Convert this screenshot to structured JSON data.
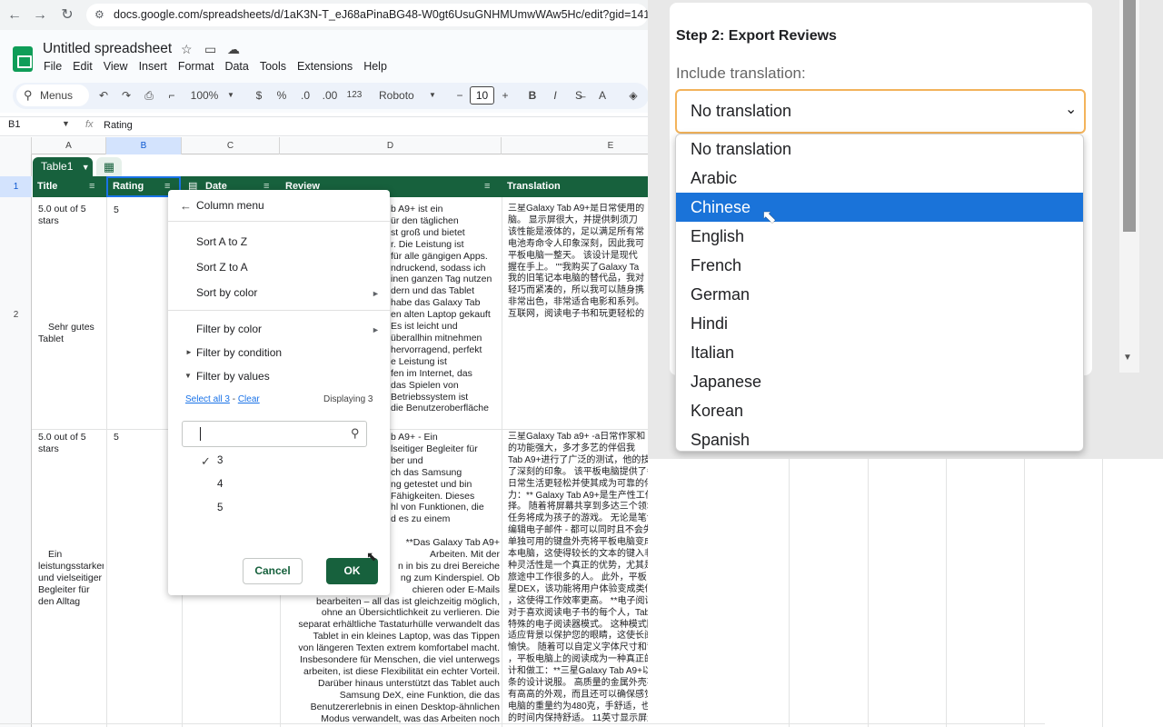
{
  "browser": {
    "url": "docs.google.com/spreadsheets/d/1aK3N-T_eJ68aPinaBG48-W0gt6UsuGNHMUmwWAw5Hc/edit?gid=141198715#gid"
  },
  "sheets": {
    "title": "Untitled spreadsheet",
    "menu": [
      "File",
      "Edit",
      "View",
      "Insert",
      "Format",
      "Data",
      "Tools",
      "Extensions",
      "Help"
    ],
    "toolbar": {
      "menus_search": "Menus",
      "zoom": "100%",
      "currency": "$",
      "percent": "%",
      "dec_decrease": ".0",
      "dec_increase": ".00",
      "number_format": "123",
      "font": "Roboto",
      "font_size": "10",
      "minus": "−",
      "plus": "+",
      "bold": "B",
      "italic": "I"
    },
    "name_box": "B1",
    "formula_value": "Rating",
    "columns": [
      "A",
      "B",
      "C",
      "D",
      "E"
    ],
    "rows": [
      "1",
      "2"
    ],
    "table_name": "Table1",
    "headers": [
      "Title",
      "Rating",
      "Date",
      "Review",
      "Translation"
    ],
    "row2": {
      "title_top": "5.0 out of 5 stars",
      "title_mid": "Sehr gutes Tablet",
      "rating": "5",
      "review": "b A9+ ist ein\nür den täglichen\nst groß und bietet\nr. Die Leistung ist\nfür alle gängigen Apps.\nndruckend, sodass ich\ninen ganzen Tag nutzen\ndern und das Tablet\nhabe das Galaxy Tab\nen alten Laptop gekauft\nEs ist leicht und\nüberallhin mitnehmen\nhervorragend, perfekt\ne Leistung ist\nfen im Internet, das\ndas Spielen von\nBetriebssystem ist\ndie Benutzeroberfläche",
      "translation": "三星Galaxy Tab A9+是日常使用的\n脑。 显示屏很大，并提供刺须刀\n该性能是液体的，足以满足所有常\n电池寿命令人印象深刻，因此我可\n平板电脑一整天。 该设计是现代\n握在手上。 \"\"我购买了Galaxy Ta\n我的旧笔记本电脑的替代品，我对\n轻巧而紧凑的，所以我可以随身携\n非常出色，非常适合电影和系列。\n互联网，阅读电子书和玩更轻松的"
    },
    "row3": {
      "title_top": "5.0 out of 5 stars",
      "title_mid": "Ein leistungsstarker und vielseitiger Begleiter für den Alltag",
      "rating": "5",
      "review_top": "b A9+ - Ein\nlseitiger Begleiter für\nber und\nch das Samsung\nng getestet und bin\nFähigkeiten. Dieses\nhl von Funktionen, die\nd es zu einem",
      "review_bottom": "**Das Galaxy Tab A9+\nArbeiten. Mit der\nn in bis zu drei Bereiche\nng zum Kinderspiel. Ob\nchieren oder E-Mails\nbearbeiten – all das ist gleichzeitig möglich,\nohne an Übersichtlichkeit zu verlieren. Die\nseparat erhältliche Tastaturhülle verwandelt das\nTablet in ein kleines Laptop, was das Tippen\nvon längeren Texten extrem komfortabel macht.\nInsbesondere für Menschen, die viel unterwegs\narbeiten, ist diese Flexibilität ein echter Vorteil.\nDarüber hinaus unterstützt das Tablet auch\nSamsung DeX, eine Funktion, die das\nBenutzererlebnis in einen Desktop-ähnlichen\nModus verwandelt, was das Arbeiten noch",
      "translation": "三星Galaxy Tab a9+ -a日常作家和\n的功能强大，多才多艺的伴侣我\nTab A9+进行了广泛的测试，他的技能给我留下\n了深刻的印象。 该平板电脑提供了各种功能，使\n日常生活更轻松并使其成为可靠的伴侣：**生产\n力：** Galaxy Tab A9+是生产性工作的理想选\n择。 随着将屏幕共享到多达三个领域的功能，多\n任务将成为孩子的游戏。 无论是笔记，研究还是\n编辑电子邮件 - 都可以同时且不会失去清晰度。\n单独可用的键盘外壳将平板电脑变成一台小笔记\n本电脑，这使得较长的文本的键入非常舒适。 这\n种灵活性是一个真正的优势，尤其是对于那些在\n旅途中工作很多的人。 此外，平板电脑还支持三\n星DEX，该功能将用户体验变成类似桌面的模式\n，这使得工作效率更高。 **电子阅读器模式：**\n对于喜欢阅读电子书的每个人，Tab A9+提供了\n特殊的电子阅读器模式。 这种模式降低了色温并\n适应背景以保护您的眼睛，这使长阅读会议更加\n愉快。 随着可以自定义字体尺寸和背景的可能性\n，平板电脑上的阅读成为一种真正的乐趣。 **设\n计和做工：**三星Galaxy Tab A9+以其优雅而苗\n条的设计说服。 高质量的金属外壳不仅使设备具\n有高高的外观，而且还可以确保感觉良好。 平板\n电脑的重量约为480克，手舒适，也可以在更长\n的时间内保持舒适。 11英寸显示屏还提供了出"
    }
  },
  "column_menu": {
    "title": "Column menu",
    "sort_a_z": "Sort A to Z",
    "sort_z_a": "Sort Z to A",
    "sort_by_color": "Sort by color",
    "filter_by_color": "Filter by color",
    "filter_by_condition": "Filter by condition",
    "filter_by_values": "Filter by values",
    "select_all": "Select all 3",
    "separator": " - ",
    "clear": "Clear",
    "displaying": "Displaying 3",
    "values": [
      {
        "label": "3",
        "checked": true
      },
      {
        "label": "4",
        "checked": false
      },
      {
        "label": "5",
        "checked": false
      }
    ],
    "cancel": "Cancel",
    "ok": "OK"
  },
  "extension": {
    "step_title": "Step 2: Export Reviews",
    "include_label": "Include translation:",
    "selected": "No translation",
    "options": [
      "No translation",
      "Arabic",
      "Chinese",
      "English",
      "French",
      "German",
      "Hindi",
      "Italian",
      "Japanese",
      "Korean",
      "Spanish"
    ],
    "highlighted": "Chinese"
  },
  "colors": {
    "table_green": "#17613d",
    "selection_blue": "#1a73d9",
    "select_border": "#f3b35b"
  }
}
